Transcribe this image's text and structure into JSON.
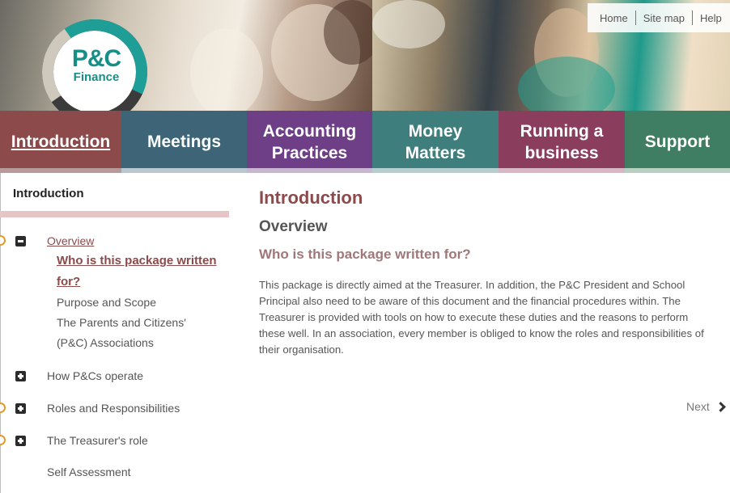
{
  "header": {
    "logo": {
      "line1": "P&C",
      "line2": "Finance"
    },
    "top_links": [
      "Home",
      "Site map",
      "Help"
    ]
  },
  "nav": [
    {
      "label": "Introduction",
      "active": true,
      "color": "#8c4a4b"
    },
    {
      "label": "Meetings",
      "color": "#3d6577"
    },
    {
      "label": "Accounting Practices",
      "color": "#6e3f86"
    },
    {
      "label": "Money Matters",
      "color": "#3e7f7d"
    },
    {
      "label": "Running a business",
      "color": "#8a3d5d"
    },
    {
      "label": "Support",
      "color": "#3f7e62"
    }
  ],
  "sidebar": {
    "title": "Introduction",
    "items": [
      {
        "label": "Overview",
        "expanded": true,
        "visited": true,
        "children": [
          "Who is this package written for?",
          "Purpose and Scope",
          "The Parents and Citizens' (P&C) Associations"
        ]
      },
      {
        "label": "How P&Cs operate",
        "expanded": false,
        "visited": false
      },
      {
        "label": "Roles and Responsibilities",
        "expanded": false,
        "visited": true
      },
      {
        "label": "The Treasurer's role",
        "expanded": false,
        "visited": true
      },
      {
        "label": "Self Assessment"
      }
    ]
  },
  "main": {
    "heading": "Introduction",
    "subheading": "Overview",
    "question": "Who is this package written for?",
    "body": "This package is directly aimed at the Treasurer. In addition, the P&C President and School Principal also need to be aware of this document and the financial procedures within. The Treasurer is provided with tools on how to execute these duties and the reasons to perform these well. In an association, every member is obliged to know the roles and responsibilities of their organisation.",
    "next_label": "Next"
  }
}
